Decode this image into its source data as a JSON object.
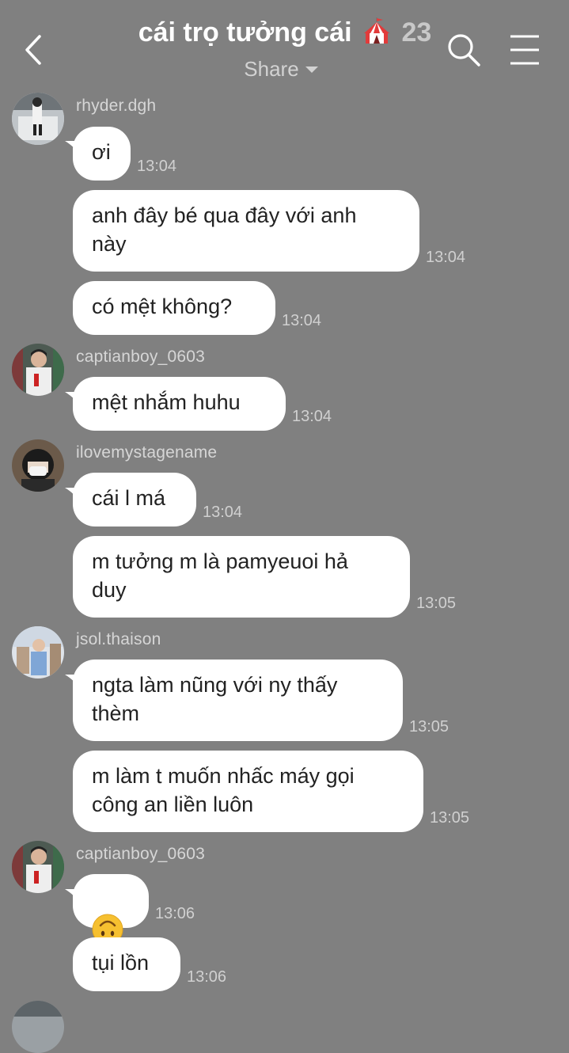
{
  "header": {
    "title": "cái trọ tưởng cái",
    "member_count": "23",
    "share_label": "Share",
    "icons": [
      "back-icon",
      "tent-icon",
      "search-icon",
      "menu-icon"
    ]
  },
  "messages": [
    {
      "sender": "rhyder.dgh",
      "text": "ơi",
      "time": "13:04"
    },
    {
      "text": "anh đây bé qua đây với anh\nnày",
      "time": "13:04"
    },
    {
      "text": "có mệt không?",
      "time": "13:04"
    },
    {
      "sender": "captianboy_0603",
      "text": "mệt nhắm huhu",
      "time": "13:04"
    },
    {
      "sender": "ilovemystagename",
      "text": "cái l má",
      "time": "13:04"
    },
    {
      "text": "m tưởng m là pamyeuoi hả\nduy",
      "time": "13:05"
    },
    {
      "sender": "jsol.thaison",
      "text": "ngta làm nũng với ny thấy\nthèm",
      "time": "13:05"
    },
    {
      "text": "m làm t muốn nhấc máy gọi\ncông an liền luôn",
      "time": "13:05"
    },
    {
      "sender": "captianboy_0603",
      "emoji": "upside-down-face",
      "time": "13:06"
    },
    {
      "text": "tụi lồn",
      "time": "13:06"
    }
  ],
  "colors": {
    "background": "#808080",
    "bubble": "#ffffff",
    "text": "#222222"
  }
}
